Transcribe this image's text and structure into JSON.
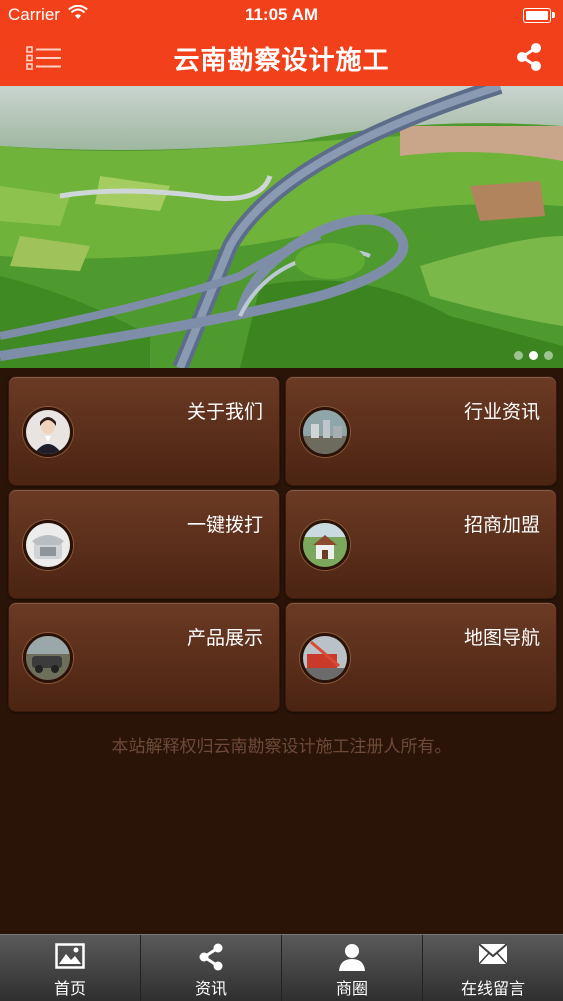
{
  "status_bar": {
    "carrier": "Carrier",
    "time": "11:05 AM"
  },
  "header": {
    "title": "云南勘察设计施工"
  },
  "banner": {
    "slide_count": 3,
    "active_slide": 2
  },
  "menu_tiles": [
    {
      "label": "关于我们",
      "icon": "receptionist-photo"
    },
    {
      "label": "行业资讯",
      "icon": "city-photo"
    },
    {
      "label": "一键拨打",
      "icon": "telephone-photo"
    },
    {
      "label": "招商加盟",
      "icon": "house-photo"
    },
    {
      "label": "产品展示",
      "icon": "vehicle-photo"
    },
    {
      "label": "地图导航",
      "icon": "machinery-photo"
    }
  ],
  "footer_note": "本站解释权归云南勘察设计施工注册人所有。",
  "tabbar": [
    {
      "label": "首页",
      "icon": "image-icon"
    },
    {
      "label": "资讯",
      "icon": "share-icon"
    },
    {
      "label": "商圈",
      "icon": "person-icon"
    },
    {
      "label": "在线留言",
      "icon": "envelope-icon"
    }
  ],
  "colors": {
    "header": "#f2401a",
    "background": "#2a1408",
    "tile": "#5a2e18",
    "tabbar": "#3f3f3f"
  }
}
